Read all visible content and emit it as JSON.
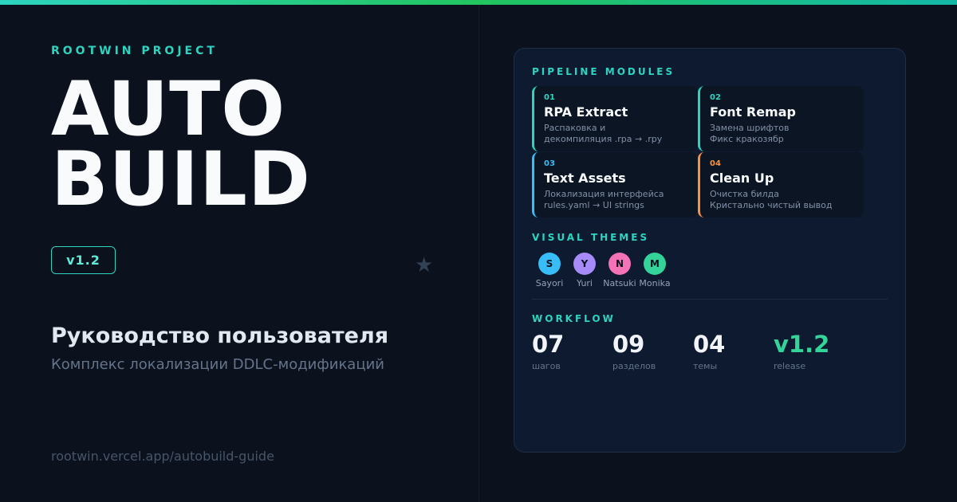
{
  "header": {
    "eyebrow": "ROOTWIN PROJECT",
    "title_line1": "AUTO",
    "title_line2": "BUILD",
    "version": "v1.2",
    "decoration": "star-icon"
  },
  "intro": {
    "subtitle": "Руководство пользователя",
    "tagline": "Комплекс локализации DDLC-модификаций",
    "url": "rootwin.vercel.app/autobuild-guide"
  },
  "pipeline": {
    "label": "PIPELINE MODULES",
    "modules": [
      {
        "num": "01",
        "title": "RPA Extract",
        "desc1": "Распаковка и",
        "desc2": "декомпиляция .rpa → .rpy",
        "accent": "#2dd4bf"
      },
      {
        "num": "02",
        "title": "Font Remap",
        "desc1": "Замена шрифтов",
        "desc2": "Фикс кракозябр",
        "accent": "#2dd4bf"
      },
      {
        "num": "03",
        "title": "Text Assets",
        "desc1": "Локализация интерфейса",
        "desc2": "rules.yaml → UI strings",
        "accent": "#38bdf8"
      },
      {
        "num": "04",
        "title": "Clean Up",
        "desc1": "Очистка билда",
        "desc2": "Кристально чистый вывод",
        "accent": "#fb923c"
      }
    ]
  },
  "themes": {
    "label": "VISUAL THEMES",
    "items": [
      {
        "initial": "S",
        "name": "Sayori",
        "color": "#38bdf8"
      },
      {
        "initial": "Y",
        "name": "Yuri",
        "color": "#a78bfa"
      },
      {
        "initial": "N",
        "name": "Natsuki",
        "color": "#f472b6"
      },
      {
        "initial": "M",
        "name": "Monika",
        "color": "#34d399"
      }
    ]
  },
  "workflow": {
    "label": "WORKFLOW",
    "stats": [
      {
        "value": "07",
        "caption": "шагов"
      },
      {
        "value": "09",
        "caption": "разделов"
      },
      {
        "value": "04",
        "caption": "темы"
      },
      {
        "value": "v1.2",
        "caption": "release"
      }
    ],
    "release_color": "#34d399"
  },
  "colors": {
    "accent": "#2dd4bf",
    "background": "#0b111d",
    "panel": "#0e1a30"
  }
}
